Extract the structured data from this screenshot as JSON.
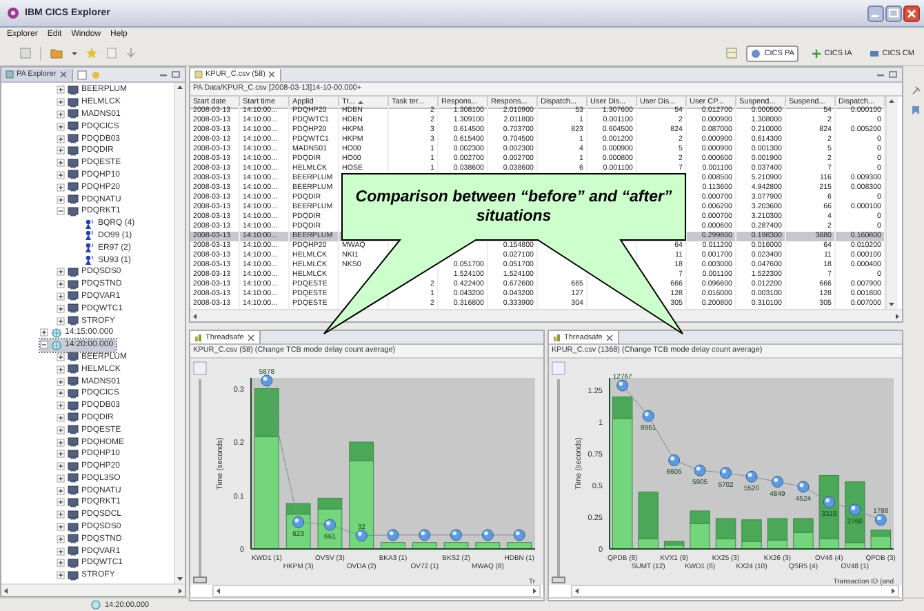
{
  "window": {
    "title": "IBM CICS Explorer"
  },
  "menu": [
    "Explorer",
    "Edit",
    "Window",
    "Help"
  ],
  "perspectives": [
    {
      "label": "CICS PA",
      "selected": true
    },
    {
      "label": "CICS IA",
      "selected": false
    },
    {
      "label": "CICS CM",
      "selected": false
    }
  ],
  "explorer": {
    "tab_title": "PA Explorer"
  },
  "tree": {
    "continued_items": [
      {
        "label": "BEERPLUM",
        "kind": "region",
        "expanded": false,
        "selected": false
      },
      {
        "label": "HELMLCK",
        "kind": "region",
        "expanded": false,
        "selected": false
      },
      {
        "label": "MADNS01",
        "kind": "region",
        "expanded": false,
        "selected": false
      },
      {
        "label": "PDQCICS",
        "kind": "region",
        "expanded": false,
        "selected": false
      },
      {
        "label": "PDQDB03",
        "kind": "region",
        "expanded": false,
        "selected": false
      },
      {
        "label": "PDQDIR",
        "kind": "region",
        "expanded": false,
        "selected": false
      },
      {
        "label": "PDQESTE",
        "kind": "region",
        "expanded": false,
        "selected": false
      },
      {
        "label": "PDQHP10",
        "kind": "region",
        "expanded": false,
        "selected": false
      },
      {
        "label": "PDQHP20",
        "kind": "region",
        "expanded": false,
        "selected": false
      },
      {
        "label": "PDQNATU",
        "kind": "region",
        "expanded": false,
        "selected": false
      },
      {
        "label": "PDQRKT1",
        "kind": "region",
        "expanded": true,
        "selected": false,
        "children": [
          {
            "label": "BQRQ (4)",
            "kind": "transaction",
            "selected": false
          },
          {
            "label": "DO99 (1)",
            "kind": "transaction",
            "selected": false
          },
          {
            "label": "ER97 (2)",
            "kind": "transaction",
            "selected": false
          },
          {
            "label": "SU93 (1)",
            "kind": "transaction",
            "selected": false
          }
        ]
      },
      {
        "label": "PDQSDS0",
        "kind": "region",
        "expanded": false,
        "selected": false
      },
      {
        "label": "PDQSTND",
        "kind": "region",
        "expanded": false,
        "selected": false
      },
      {
        "label": "PDQVAR1",
        "kind": "region",
        "expanded": false,
        "selected": false
      },
      {
        "label": "PDQWTC1",
        "kind": "region",
        "expanded": false,
        "selected": false
      },
      {
        "label": "STROFY",
        "kind": "region",
        "expanded": false,
        "selected": false
      }
    ],
    "items": [
      {
        "label": "14:15:00.000",
        "kind": "interval",
        "expanded": false,
        "selected": false
      },
      {
        "label": "14:20:00.000",
        "kind": "interval",
        "expanded": true,
        "selected": true,
        "children": [
          {
            "label": "BEERPLUM",
            "kind": "region",
            "expanded": false,
            "selected": false
          },
          {
            "label": "HELMLCK",
            "kind": "region",
            "expanded": false,
            "selected": false
          },
          {
            "label": "MADNS01",
            "kind": "region",
            "expanded": false,
            "selected": false
          },
          {
            "label": "PDQCICS",
            "kind": "region",
            "expanded": false,
            "selected": false
          },
          {
            "label": "PDQDB03",
            "kind": "region",
            "expanded": false,
            "selected": false
          },
          {
            "label": "PDQDIR",
            "kind": "region",
            "expanded": false,
            "selected": false
          },
          {
            "label": "PDQESTE",
            "kind": "region",
            "expanded": false,
            "selected": false
          },
          {
            "label": "PDQHOME",
            "kind": "region",
            "expanded": false,
            "selected": false
          },
          {
            "label": "PDQHP10",
            "kind": "region",
            "expanded": false,
            "selected": false
          },
          {
            "label": "PDQHP20",
            "kind": "region",
            "expanded": false,
            "selected": false
          },
          {
            "label": "PDQL3SO",
            "kind": "region",
            "expanded": false,
            "selected": false
          },
          {
            "label": "PDQNATU",
            "kind": "region",
            "expanded": false,
            "selected": false
          },
          {
            "label": "PDQRKT1",
            "kind": "region",
            "expanded": false,
            "selected": false
          },
          {
            "label": "PDQSDCL",
            "kind": "region",
            "expanded": false,
            "selected": false
          },
          {
            "label": "PDQSDS0",
            "kind": "region",
            "expanded": false,
            "selected": false
          },
          {
            "label": "PDQSTND",
            "kind": "region",
            "expanded": false,
            "selected": false
          },
          {
            "label": "PDQVAR1",
            "kind": "region",
            "expanded": false,
            "selected": false
          },
          {
            "label": "PDQWTC1",
            "kind": "region",
            "expanded": false,
            "selected": false
          },
          {
            "label": "STROFY",
            "kind": "region",
            "expanded": false,
            "selected": false
          }
        ]
      }
    ]
  },
  "editor": {
    "tab_title": "KPUR_C.csv (58)",
    "path": "PA Data/KPUR_C.csv [2008-03-13]14-10-00.000+",
    "table": {
      "columns": [
        {
          "label": "Start date",
          "kind": "text"
        },
        {
          "label": "Start time",
          "kind": "text"
        },
        {
          "label": "Applid",
          "kind": "text"
        },
        {
          "label": "Tr...",
          "kind": "text",
          "sorted": true
        },
        {
          "label": "Task ter...",
          "kind": "number"
        },
        {
          "label": "Respons...",
          "kind": "number"
        },
        {
          "label": "Respons...",
          "kind": "number"
        },
        {
          "label": "Dispatch...",
          "kind": "number"
        },
        {
          "label": "User Dis...",
          "kind": "number"
        },
        {
          "label": "User Dis...",
          "kind": "number"
        },
        {
          "label": "User CP...",
          "kind": "number"
        },
        {
          "label": "Suspend...",
          "kind": "number"
        },
        {
          "label": "Suspend...",
          "kind": "number"
        },
        {
          "label": "Dispatch...",
          "kind": "number"
        }
      ],
      "rows": [
        {
          "selected": false,
          "cells": [
            "2008-03-13",
            "14:10:00...",
            "PDQHP20",
            "HDBN",
            "2",
            "1.308100",
            "2.010900",
            "53",
            "1.307600",
            "54",
            "0.012700",
            "0.000500",
            "54",
            "0.000100"
          ]
        },
        {
          "selected": false,
          "cells": [
            "2008-03-13",
            "14:10:00...",
            "PDQWTC1",
            "HDBN",
            "2",
            "1.309100",
            "2.011800",
            "1",
            "0.001100",
            "2",
            "0.000900",
            "1.308000",
            "2",
            "0"
          ]
        },
        {
          "selected": false,
          "cells": [
            "2008-03-13",
            "14:10:00...",
            "PDQHP20",
            "HKPM",
            "3",
            "0.614500",
            "0.703700",
            "823",
            "0.604500",
            "824",
            "0.087000",
            "0.210000",
            "824",
            "0.005200"
          ]
        },
        {
          "selected": false,
          "cells": [
            "2008-03-13",
            "14:10:00...",
            "PDQWTC1",
            "HKPM",
            "3",
            "0.615400",
            "0.704500",
            "1",
            "0.001200",
            "2",
            "0.000900",
            "0.614300",
            "2",
            "0"
          ]
        },
        {
          "selected": false,
          "cells": [
            "2008-03-13",
            "14:10:00...",
            "MADNS01",
            "HO00",
            "1",
            "0.002300",
            "0.002300",
            "4",
            "0.000900",
            "5",
            "0.000900",
            "0.001300",
            "5",
            "0"
          ]
        },
        {
          "selected": false,
          "cells": [
            "2008-03-13",
            "14:10:00...",
            "PDQDIR",
            "HO00",
            "1",
            "0.002700",
            "0.002700",
            "1",
            "0.000800",
            "2",
            "0.000600",
            "0.001900",
            "2",
            "0"
          ]
        },
        {
          "selected": false,
          "cells": [
            "2008-03-13",
            "14:10:00...",
            "HELMLCK",
            "HOSE",
            "1",
            "0.038600",
            "0.038600",
            "6",
            "0.001100",
            "7",
            "0.001100",
            "0.037400",
            "7",
            "0"
          ]
        },
        {
          "selected": false,
          "cells": [
            "2008-03-13",
            "14:10:00...",
            "BEERPLUM",
            null,
            null,
            null,
            null,
            null,
            null,
            null,
            "0.008500",
            "5.210900",
            "116",
            "0.009300"
          ]
        },
        {
          "selected": false,
          "cells": [
            "2008-03-13",
            "14:10:00...",
            "BEERPLUM",
            null,
            null,
            null,
            null,
            null,
            null,
            null,
            "0.113600",
            "4.942800",
            "215",
            "0.008300"
          ]
        },
        {
          "selected": false,
          "cells": [
            "2008-03-13",
            "14:10:00...",
            "PDQDIR",
            null,
            null,
            null,
            null,
            null,
            null,
            null,
            "0.000700",
            "3.077900",
            "6",
            "0"
          ]
        },
        {
          "selected": false,
          "cells": [
            "2008-03-13",
            "14:10:00...",
            "BEERPLUM",
            null,
            null,
            null,
            null,
            null,
            null,
            null,
            "0.006200",
            "3.203600",
            "66",
            "0.000100"
          ]
        },
        {
          "selected": false,
          "cells": [
            "2008-03-13",
            "14:10:00...",
            "PDQDIR",
            null,
            null,
            null,
            null,
            null,
            null,
            null,
            "0.000700",
            "3.210300",
            "4",
            "0"
          ]
        },
        {
          "selected": false,
          "cells": [
            "2008-03-13",
            "14:10:00...",
            "PDQDIR",
            null,
            null,
            null,
            null,
            null,
            null,
            null,
            "0.000600",
            "0.287400",
            "2",
            "0"
          ]
        },
        {
          "selected": true,
          "cells": [
            "2008-03-13",
            "14:10:00...",
            "BEERPLUM",
            null,
            null,
            null,
            null,
            null,
            null,
            null,
            "0.299800",
            "0.198300",
            "3880",
            "0.160800"
          ]
        },
        {
          "selected": false,
          "cells": [
            "2008-03-13",
            "14:10:00...",
            "PDQHP20",
            "MWAQ",
            null,
            null,
            "0.154800",
            null,
            null,
            "64",
            "0.011200",
            "0.016000",
            "64",
            "0.010200"
          ]
        },
        {
          "selected": false,
          "cells": [
            "2008-03-13",
            "14:10:00...",
            "HELMLCK",
            "NKI1",
            null,
            null,
            "0.027100",
            null,
            null,
            "11",
            "0.001700",
            "0.023400",
            "11",
            "0.000100"
          ]
        },
        {
          "selected": false,
          "cells": [
            "2008-03-13",
            "14:10:00...",
            "HELMLCK",
            "NKS0",
            null,
            "0.051700",
            "0.051700",
            null,
            null,
            "18",
            "0.003000",
            "0.047600",
            "18",
            "0.000400"
          ]
        },
        {
          "selected": false,
          "cells": [
            "2008-03-13",
            "14:10:00...",
            "HELMLCK",
            null,
            null,
            "1.524100",
            "1.524100",
            null,
            null,
            "7",
            "0.001100",
            "1.522300",
            "7",
            "0"
          ]
        },
        {
          "selected": false,
          "cells": [
            "2008-03-13",
            "14:10:00...",
            "PDQESTE",
            null,
            "2",
            "0.422400",
            "0.672600",
            "665",
            null,
            "666",
            "0.096600",
            "0.012200",
            "666",
            "0.007900"
          ]
        },
        {
          "selected": false,
          "cells": [
            "2008-03-13",
            "14:10:00...",
            "PDQESTE",
            null,
            "1",
            "0.043200",
            "0.043200",
            "127",
            null,
            "128",
            "0.016000",
            "0.003100",
            "128",
            "0.001800"
          ]
        },
        {
          "selected": false,
          "cells": [
            "2008-03-13",
            "14:10:00...",
            "PDQESTE",
            null,
            "2",
            "0.316800",
            "0.333900",
            "304",
            null,
            "305",
            "0.200800",
            "0.310100",
            "305",
            "0.007000"
          ]
        }
      ]
    }
  },
  "charts": [
    {
      "tab_title": "Threadsafe",
      "subtitle": "KPUR_C.csv (58) (Change TCB mode delay count average)",
      "chart_data": {
        "type": "bar",
        "stacked": true,
        "ylabel": "Time (seconds)",
        "xlabel": "Tr",
        "ylim": [
          0,
          0.32
        ],
        "yticks": [
          {
            "value": 0,
            "label": "0"
          },
          {
            "value": 0.1,
            "label": "0.1"
          },
          {
            "value": 0.2,
            "label": "0.2"
          },
          {
            "value": 0.3,
            "label": "0.3"
          }
        ],
        "categories": [
          "KWD1 (1)",
          "HKPM (3)",
          "OVSV (3)",
          "OVDA (2)",
          "BKA3 (1)",
          "OV72 (1)",
          "BKS2 (2)",
          "MWAQ (8)",
          "HDBN (1)"
        ],
        "series": [
          {
            "color": "#74d67c",
            "values": [
              0.21,
              0.065,
              0.075,
              0.165,
              0.012,
              0.012,
              0.012,
              0.012,
              0.012
            ]
          },
          {
            "color": "#4aa858",
            "values": [
              0.09,
              0.02,
              0.02,
              0.035,
              null,
              null,
              null,
              null,
              null
            ]
          },
          {
            "type": "line",
            "marker": "circle",
            "color": "#5d9ae0",
            "values": [
              0.315,
              0.05,
              0.045,
              0.025,
              0.026,
              0.026,
              0.026,
              0.026,
              0.026
            ]
          }
        ],
        "annotations": [
          "5878",
          "623",
          "661",
          "32"
        ]
      },
      "slider": {
        "level": 0
      }
    },
    {
      "tab_title": "Threadsafe",
      "subtitle": "KPUR_C.csv (1368) (Change TCB mode delay count average)",
      "chart_data": {
        "type": "bar",
        "stacked": true,
        "ylabel": "Time (seconds)",
        "xlabel": "Transaction ID (and",
        "ylim": [
          0,
          1.35
        ],
        "yticks": [
          {
            "value": 0,
            "label": "0"
          },
          {
            "value": 0.25,
            "label": "0.25"
          },
          {
            "value": 0.5,
            "label": "0.5"
          },
          {
            "value": 0.75,
            "label": "0.75"
          },
          {
            "value": 1,
            "label": "1"
          },
          {
            "value": 1.25,
            "label": "1.25"
          }
        ],
        "categories": [
          "QPDB (6)",
          "SUMT (12)",
          "KVX1 (9)",
          "KWD1 (6)",
          "KX25 (3)",
          "KX24 (10)",
          "KX26 (3)",
          "QSR5 (4)",
          "OV46 (4)",
          "OV48 (1)",
          "QPDB (3)"
        ],
        "series": [
          {
            "color": "#74d67c",
            "values": [
              1.03,
              0.08,
              0.03,
              0.2,
              0.08,
              0.06,
              0.07,
              0.13,
              0.08,
              0.05,
              0.1
            ]
          },
          {
            "color": "#4aa858",
            "values": [
              0.17,
              0.37,
              0.03,
              0.1,
              0.16,
              0.17,
              0.17,
              0.11,
              0.5,
              0.48,
              0.05
            ]
          },
          {
            "type": "line",
            "marker": "circle",
            "color": "#5d9ae0",
            "values": [
              1.29,
              1.05,
              0.7,
              0.62,
              0.6,
              0.57,
              0.53,
              0.49,
              0.37,
              0.31,
              0.23
            ]
          }
        ],
        "annotations": [
          "12767",
          "8961",
          "6605",
          "5905",
          "5702",
          "5520",
          "4849",
          "4524",
          "3319",
          "2760",
          "1788"
        ]
      },
      "slider": {
        "level": 0
      }
    }
  ],
  "callout": {
    "text": "Comparison between “before” and “after” situations"
  },
  "status_bar": {
    "text": "14:20:00.000"
  }
}
